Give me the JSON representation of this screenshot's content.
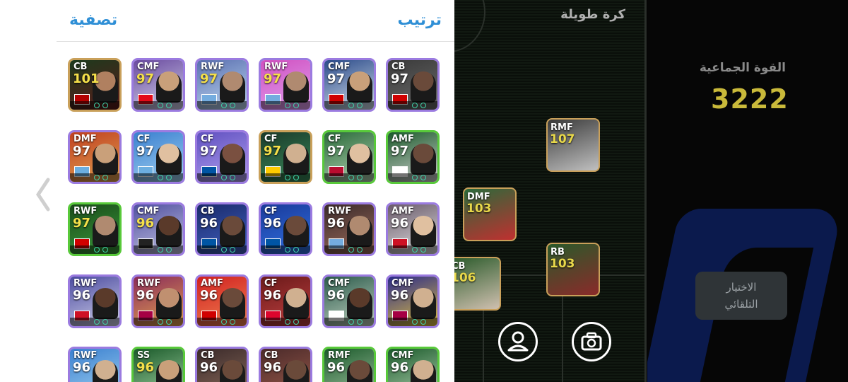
{
  "sheet": {
    "sort_label": "ترتيب",
    "filter_label": "تصفية"
  },
  "mode_title": "كرة طويلة",
  "team_strength": {
    "label": "القوة الجماعية",
    "value": "3222"
  },
  "auto_select_label": "الاختيار\nالتلقائي",
  "colors": {
    "accent_blue": "#2f8fd6",
    "strength_gold": "#c9b93a",
    "card_border_purple": "#9b7be0",
    "card_border_green": "#58c93a",
    "card_border_gold": "#c9a05a"
  },
  "cards": [
    {
      "pos": "CB",
      "rating": "101",
      "rating_color": "#f5e04a",
      "border": "#c9a05a",
      "bg": [
        "#1d3a1d",
        "#5a1a1a"
      ],
      "face": "#b08060",
      "flag": "#b30000"
    },
    {
      "pos": "CMF",
      "rating": "97",
      "rating_color": "#f5e04a",
      "border": "#9b7be0",
      "bg": [
        "#6a4aa0",
        "#d0d0e8"
      ],
      "face": "#c9a07a",
      "flag": "#e30a17"
    },
    {
      "pos": "RWF",
      "rating": "97",
      "rating_color": "#f5e04a",
      "border": "#9b7be0",
      "bg": [
        "#5a6fb0",
        "#bcd7f0"
      ],
      "face": "#b08a70",
      "flag": "#74acdf"
    },
    {
      "pos": "RWF",
      "rating": "97",
      "rating_color": "#f5e04a",
      "border": "#9b7be0",
      "bg": [
        "#d050c0",
        "#e0a0f0"
      ],
      "face": "#b08a70",
      "flag": "#74acdf"
    },
    {
      "pos": "CMF",
      "rating": "97",
      "rating_color": "#ffffff",
      "border": "#9b7be0",
      "bg": [
        "#2a4a8a",
        "#d0dde8"
      ],
      "face": "#c9a07a",
      "flag": "#d00000"
    },
    {
      "pos": "CB",
      "rating": "97",
      "rating_color": "#ffffff",
      "border": "#9b7be0",
      "bg": [
        "#3a3a3a",
        "#6a6a6a"
      ],
      "face": "#6a4a3a",
      "flag": "#d00000"
    },
    {
      "pos": "DMF",
      "rating": "97",
      "rating_color": "#ffffff",
      "border": "#9b7be0",
      "bg": [
        "#c04020",
        "#e0a050"
      ],
      "face": "#c9a07a",
      "flag": "#6caee0"
    },
    {
      "pos": "CF",
      "rating": "97",
      "rating_color": "#ffffff",
      "border": "#9b7be0",
      "bg": [
        "#3a80d0",
        "#a0d0f0"
      ],
      "face": "#e0c0a0",
      "flag": "#6caee0"
    },
    {
      "pos": "CF",
      "rating": "97",
      "rating_color": "#ffffff",
      "border": "#9b7be0",
      "bg": [
        "#6050c0",
        "#b0a0f0"
      ],
      "face": "#7a5040",
      "flag": "#0055a4"
    },
    {
      "pos": "CF",
      "rating": "97",
      "rating_color": "#f5e04a",
      "border": "#c9a05a",
      "bg": [
        "#1a3a2a",
        "#3a8a5a"
      ],
      "face": "#d0b090",
      "flag": "#ffcc00"
    },
    {
      "pos": "CF",
      "rating": "97",
      "rating_color": "#ffffff",
      "border": "#58c93a",
      "bg": [
        "#2a6a3a",
        "#b0d0b0"
      ],
      "face": "#e0c0a0",
      "flag": "#ba0c2f"
    },
    {
      "pos": "AMF",
      "rating": "97",
      "rating_color": "#ffffff",
      "border": "#58c93a",
      "bg": [
        "#1a5a2a",
        "#d0d0d0"
      ],
      "face": "#6a4a3a",
      "flag": "#ffffff"
    },
    {
      "pos": "RWF",
      "rating": "97",
      "rating_color": "#f5e04a",
      "border": "#58c93a",
      "bg": [
        "#1a4a1a",
        "#3a9a3a"
      ],
      "face": "#b08a70",
      "flag": "#d00000"
    },
    {
      "pos": "CMF",
      "rating": "96",
      "rating_color": "#f5e04a",
      "border": "#9b7be0",
      "bg": [
        "#5050a0",
        "#c0c0e0"
      ],
      "face": "#5a3a2a",
      "flag": "#222222"
    },
    {
      "pos": "CB",
      "rating": "96",
      "rating_color": "#ffffff",
      "border": "#9b7be0",
      "bg": [
        "#1a2a6a",
        "#4060c0"
      ],
      "face": "#6a4a3a",
      "flag": "#0055a4"
    },
    {
      "pos": "CF",
      "rating": "96",
      "rating_color": "#ffffff",
      "border": "#9b7be0",
      "bg": [
        "#1a3a9a",
        "#3070e0"
      ],
      "face": "#6a4a3a",
      "flag": "#0055a4"
    },
    {
      "pos": "RWF",
      "rating": "96",
      "rating_color": "#ffffff",
      "border": "#9b7be0",
      "bg": [
        "#3a2a2a",
        "#9a6a5a"
      ],
      "face": "#b08a70",
      "flag": "#74acdf"
    },
    {
      "pos": "AMF",
      "rating": "96",
      "rating_color": "#ffffff",
      "border": "#9b7be0",
      "bg": [
        "#6a5a6a",
        "#e0e0e0"
      ],
      "face": "#e0c0a0",
      "flag": "#ce1124"
    },
    {
      "pos": "RWF",
      "rating": "96",
      "rating_color": "#ffffff",
      "border": "#9b7be0",
      "bg": [
        "#4a4aa0",
        "#d0d0e8"
      ],
      "face": "#5a3a2a",
      "flag": "#ce1124"
    },
    {
      "pos": "RWF",
      "rating": "96",
      "rating_color": "#ffffff",
      "border": "#9b7be0",
      "bg": [
        "#8a2a5a",
        "#e0a050"
      ],
      "face": "#c09070",
      "flag": "#a50044"
    },
    {
      "pos": "AMF",
      "rating": "96",
      "rating_color": "#ffffff",
      "border": "#9b7be0",
      "bg": [
        "#d02020",
        "#f08050"
      ],
      "face": "#6a4a3a",
      "flag": "#d00000"
    },
    {
      "pos": "CF",
      "rating": "96",
      "rating_color": "#ffffff",
      "border": "#9b7be0",
      "bg": [
        "#6a1a1a",
        "#c04040"
      ],
      "face": "#d0b090",
      "flag": "#dc052d"
    },
    {
      "pos": "CMF",
      "rating": "96",
      "rating_color": "#ffffff",
      "border": "#9b7be0",
      "bg": [
        "#2a5a4a",
        "#c0d0c0"
      ],
      "face": "#5a3a2a",
      "flag": "#ffffff"
    },
    {
      "pos": "CMF",
      "rating": "96",
      "rating_color": "#ffffff",
      "border": "#9b7be0",
      "bg": [
        "#2a2a8a",
        "#e0c040"
      ],
      "face": "#d0b090",
      "flag": "#a50044"
    },
    {
      "pos": "RWF",
      "rating": "96",
      "rating_color": "#ffffff",
      "border": "#9b7be0",
      "bg": [
        "#3a80d0",
        "#a0d0f0"
      ],
      "face": "#d0b090",
      "flag": "#6caee0"
    },
    {
      "pos": "SS",
      "rating": "96",
      "rating_color": "#f5e04a",
      "border": "#58c93a",
      "bg": [
        "#1a5a2a",
        "#a0d0a0"
      ],
      "face": "#c9a07a",
      "flag": "#ffffff"
    },
    {
      "pos": "CB",
      "rating": "96",
      "rating_color": "#ffffff",
      "border": "#9b7be0",
      "bg": [
        "#3a2a2a",
        "#8a6a5a"
      ],
      "face": "#6a4a3a",
      "flag": "#d00000"
    },
    {
      "pos": "CB",
      "rating": "96",
      "rating_color": "#ffffff",
      "border": "#9b7be0",
      "bg": [
        "#4a2a2a",
        "#9a5a4a"
      ],
      "face": "#6a4a3a",
      "flag": "#d00000"
    },
    {
      "pos": "RMF",
      "rating": "96",
      "rating_color": "#ffffff",
      "border": "#58c93a",
      "bg": [
        "#1a5a2a",
        "#a0c0a0"
      ],
      "face": "#6a4a3a",
      "flag": "#ffffff"
    },
    {
      "pos": "CMF",
      "rating": "96",
      "rating_color": "#ffffff",
      "border": "#58c93a",
      "bg": [
        "#1a5a2a",
        "#b0d0b0"
      ],
      "face": "#d0b090",
      "flag": "#ffffff"
    }
  ],
  "pitch_players": [
    {
      "pos": "RMF",
      "rating": "107"
    },
    {
      "pos": "DMF",
      "rating": "103"
    },
    {
      "pos": "RB",
      "rating": "103"
    },
    {
      "pos": "CB",
      "rating": "106"
    }
  ]
}
